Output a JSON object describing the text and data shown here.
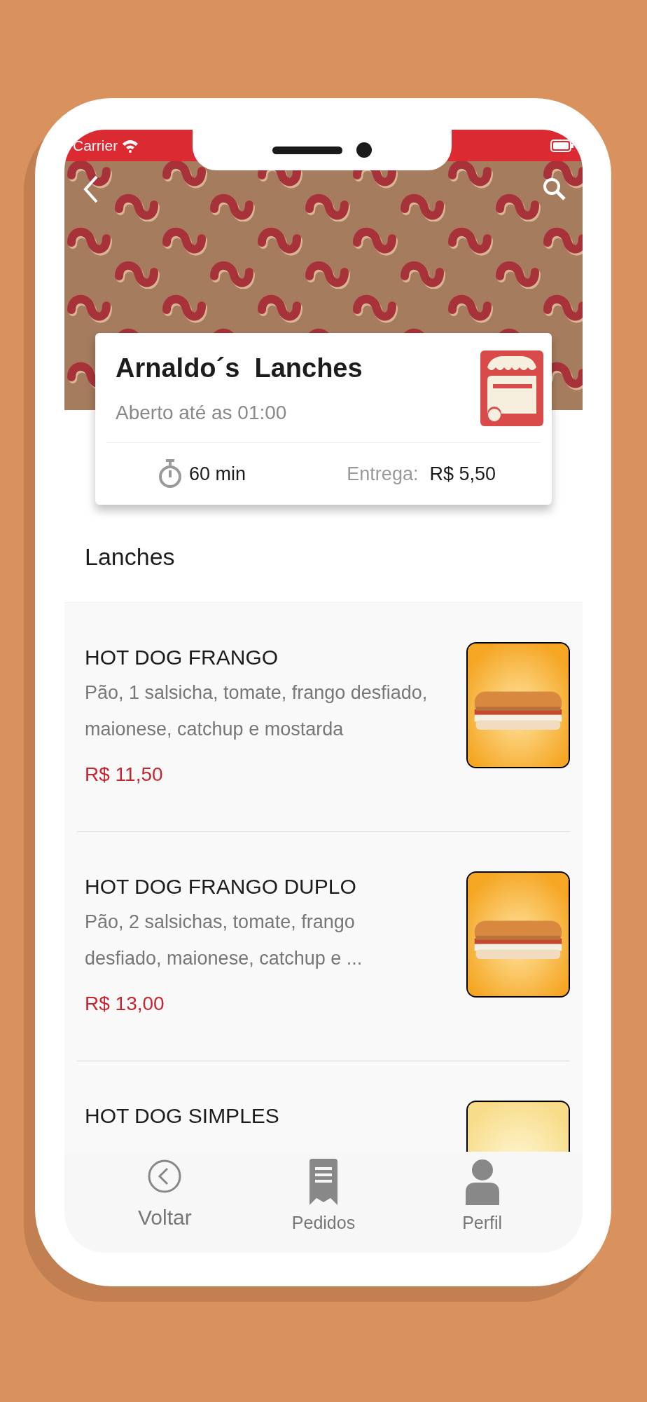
{
  "status_bar": {
    "carrier": "Carrier"
  },
  "store": {
    "name": "Arnaldo´s  Lanches",
    "hours": "Aberto até as 01:00",
    "time": "60 min",
    "delivery_label": "Entrega:",
    "delivery_fee": "R$ 5,50"
  },
  "section_title": "Lanches",
  "items": [
    {
      "name": "HOT DOG FRANGO",
      "description": "Pão, 1 salsicha, tomate, frango desfiado, maionese, catchup e mostarda",
      "price": "R$ 11,50",
      "kind": "picture"
    },
    {
      "name": "HOT DOG FRANGO DUPLO",
      "description": "Pão, 2 salsichas, tomate, frango desfiado, maionese, catchup e ...",
      "price": "R$ 13,00",
      "kind": "picture"
    },
    {
      "name": "HOT DOG SIMPLES",
      "kind": "picture"
    }
  ],
  "nav": [
    {
      "label": "Voltar",
      "kind": "back"
    },
    {
      "label": "Pedidos",
      "kind": "orders"
    },
    {
      "label": "Perfil",
      "kind": "profile"
    }
  ]
}
